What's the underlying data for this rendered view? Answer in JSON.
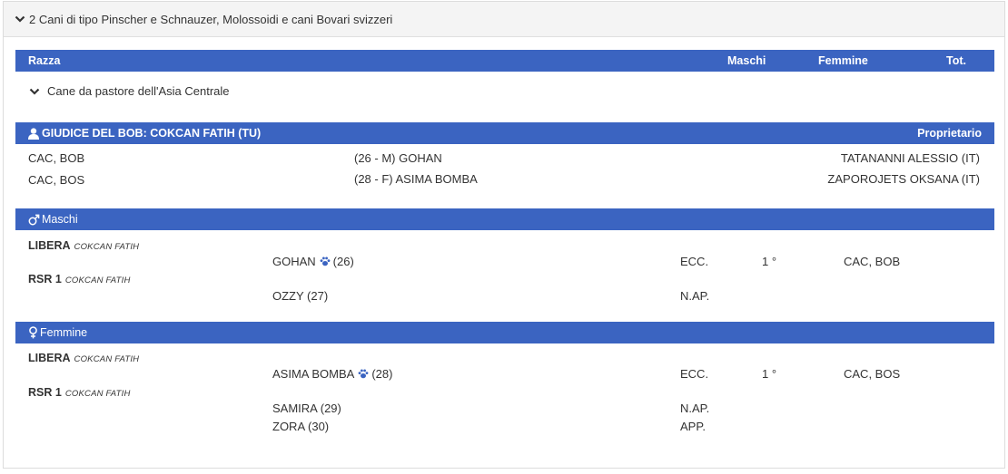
{
  "group": {
    "title": "2 Cani di tipo Pinscher e Schnauzer, Molossoidi e cani Bovari svizzeri",
    "icon": "chevron-down-icon"
  },
  "table_header": {
    "breed": "Razza",
    "males": "Maschi",
    "females": "Femmine",
    "total": "Tot."
  },
  "breed": {
    "name": "Cane da pastore dell'Asia Centrale",
    "icon": "chevron-down-icon"
  },
  "bob": {
    "title": "GIUDICE DEL BOB: COKCAN FATIH (TU)",
    "owner_label": "Proprietario",
    "icon": "user-icon",
    "rows": [
      {
        "title": "CAC, BOB",
        "dog": "(26 - M) GOHAN",
        "owner": "TATANANNI ALESSIO (IT)"
      },
      {
        "title": "CAC, BOS",
        "dog": "(28 - F) ASIMA BOMBA",
        "owner": "ZAPOROJETS OKSANA (IT)"
      }
    ]
  },
  "males": {
    "label": "Maschi",
    "icon": "male-symbol-icon",
    "classes": [
      {
        "name": "LIBERA",
        "judge": "COKCAN FATIH"
      },
      {
        "name": "RSR 1",
        "judge": "COKCAN FATIH"
      }
    ],
    "entries": [
      {
        "dog": "GOHAN",
        "number": "(26)",
        "paw": true,
        "rating": "ECC.",
        "place": "1 °",
        "award": "CAC, BOB"
      },
      {
        "dog": "OZZY (27)",
        "rating": "N.AP."
      }
    ]
  },
  "females": {
    "label": "Femmine",
    "icon": "female-symbol-icon",
    "classes": [
      {
        "name": "LIBERA",
        "judge": "COKCAN FATIH"
      },
      {
        "name": "RSR 1",
        "judge": "COKCAN FATIH"
      }
    ],
    "entries": [
      {
        "dog": "ASIMA BOMBA",
        "number": "(28)",
        "paw": true,
        "rating": "ECC.",
        "place": "1 °",
        "award": "CAC, BOS"
      },
      {
        "dog": "SAMIRA (29)",
        "rating": "N.AP."
      },
      {
        "dog": "ZORA (30)",
        "rating": "APP."
      }
    ]
  },
  "colors": {
    "bar_blue": "#3b64c1",
    "paw_blue": "#3b64c1",
    "header_bg": "#f4f4f4"
  }
}
